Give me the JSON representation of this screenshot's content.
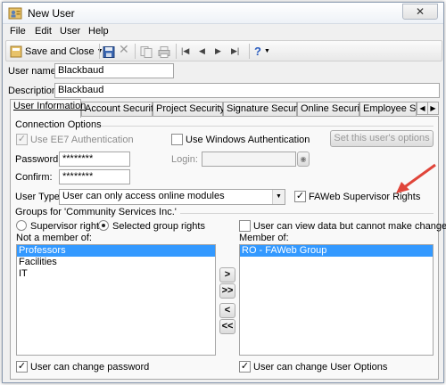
{
  "window": {
    "title": "New User",
    "close": "✕"
  },
  "menu": [
    "File",
    "Edit",
    "User",
    "Help"
  ],
  "toolbar": {
    "save_close": "Save and Close",
    "help": "?"
  },
  "user_name": {
    "label": "User name:",
    "value": "Blackbaud"
  },
  "description": {
    "label": "Description:",
    "value": "Blackbaud"
  },
  "tabs": [
    {
      "label": "User Information",
      "active": true
    },
    {
      "label": "Account Security",
      "active": false
    },
    {
      "label": "Project Security",
      "active": false
    },
    {
      "label": "Signature Security",
      "active": false
    },
    {
      "label": "Online Security",
      "active": false
    },
    {
      "label": "Employee Securi",
      "active": false
    }
  ],
  "connection": {
    "title": "Connection Options",
    "use_ee7": "Use EE7 Authentication",
    "use_windows": "Use Windows Authentication",
    "set_options": "Set this user's options",
    "password_label": "Password:",
    "password_value": "********",
    "confirm_label": "Confirm:",
    "confirm_value": "********",
    "login_label": "Login:",
    "login_value": "",
    "user_type_label": "User Type:",
    "user_type_value": "User can only access online modules",
    "faweb": "FAWeb Supervisor Rights"
  },
  "groups": {
    "title": "Groups for 'Community Services Inc.'",
    "supervisor": "Supervisor rights",
    "selected": "Selected group rights",
    "view_all": "User can view data but cannot make changes",
    "not_member_label": "Not a member of:",
    "member_label": "Member of:",
    "not_member": [
      "Professors",
      "Facilities",
      "IT"
    ],
    "member": [
      "RO - FAWeb Group"
    ],
    "btn_add": ">",
    "btn_add_all": ">>",
    "btn_remove": "<",
    "btn_remove_all": "<<",
    "change_password": "User can change password",
    "change_options": "User can change User Options"
  },
  "colors": {
    "accent_arrow": "#e0453a",
    "selection": "#3399ff"
  }
}
